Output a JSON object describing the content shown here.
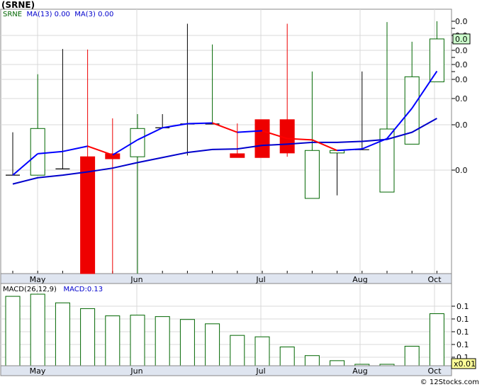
{
  "header": {
    "title": "(SRNE)",
    "legend_symbol": "SRNE",
    "legend_ma13": "MA(13)",
    "legend_ma13_value": "0.00",
    "legend_ma3": "MA(3)",
    "legend_ma3_value": "0.00"
  },
  "macd_panel": {
    "label": "MACD(26,12,9)",
    "value_label": "MACD:0.13"
  },
  "footer": {
    "credit": "© 12Stocks.com"
  },
  "colors": {
    "up_candle": "#006600",
    "down_candle": "#ee0000",
    "ma13": "#0000cc",
    "ma3_up": "#0000ff",
    "ma3_down": "#ff0000",
    "grid": "#d9d9d9",
    "axis_bg": "#dfe5f0",
    "last_price_box": "#ccffcc"
  },
  "chart_data": [
    {
      "type": "candlestick",
      "series_name": "SRNE",
      "x_tick_labels": [
        "May",
        "Jun",
        "Jul",
        "Aug",
        "Oct"
      ],
      "y_tick_labels": [
        "0.0",
        "0.0",
        "0.0",
        "0.0",
        "0.0",
        "0.0",
        "0.0",
        "0.0",
        "0.0"
      ],
      "last_value_label": "0.0",
      "grid": true,
      "ylim": [
        0,
        1
      ],
      "candles": [
        {
          "open": 0.39,
          "high": 0.56,
          "low": 0.39,
          "close": 0.39
        },
        {
          "open": 0.39,
          "high": 0.79,
          "low": 0.39,
          "close": 0.575
        },
        {
          "open": 0.415,
          "high": 0.89,
          "low": 0.415,
          "close": 0.415
        },
        {
          "open": 0.463,
          "high": 0.888,
          "low": 0.0,
          "close": 0.0
        },
        {
          "open": 0.475,
          "high": 0.615,
          "low": 0.0,
          "close": 0.455
        },
        {
          "open": 0.463,
          "high": 0.632,
          "low": 0.0,
          "close": 0.575
        },
        {
          "open": 0.578,
          "high": 0.632,
          "low": 0.578,
          "close": 0.578
        },
        {
          "open": 0.593,
          "high": 0.99,
          "low": 0.468,
          "close": 0.593
        },
        {
          "open": 0.593,
          "high": 0.908,
          "low": 0.593,
          "close": 0.593
        },
        {
          "open": 0.475,
          "high": 0.595,
          "low": 0.475,
          "close": 0.46
        },
        {
          "open": 0.61,
          "high": 0.61,
          "low": 0.463,
          "close": 0.46
        },
        {
          "open": 0.61,
          "high": 0.99,
          "low": 0.463,
          "close": 0.478
        },
        {
          "open": 0.298,
          "high": 0.801,
          "low": 0.298,
          "close": 0.488
        },
        {
          "open": 0.478,
          "high": 0.491,
          "low": 0.31,
          "close": 0.488
        },
        {
          "open": 0.491,
          "high": 0.801,
          "low": 0.491,
          "close": 0.491
        },
        {
          "open": 0.323,
          "high": 0.997,
          "low": 0.323,
          "close": 0.573
        },
        {
          "open": 0.513,
          "high": 0.919,
          "low": 0.513,
          "close": 0.78
        },
        {
          "open": 0.76,
          "high": 1.0,
          "low": 0.76,
          "close": 0.93
        }
      ],
      "ma3": [
        0.39,
        0.475,
        0.484,
        0.505,
        0.47,
        0.53,
        0.578,
        0.594,
        0.597,
        0.56,
        0.566,
        0.535,
        0.53,
        0.488,
        0.494,
        0.535,
        0.655,
        0.802
      ],
      "ma13": [
        0.355,
        0.38,
        0.39,
        0.403,
        0.418,
        0.44,
        0.46,
        0.48,
        0.492,
        0.494,
        0.508,
        0.513,
        0.52,
        0.52,
        0.524,
        0.532,
        0.56,
        0.615
      ]
    },
    {
      "type": "bar",
      "series_name": "MACD",
      "x_tick_labels": [
        "May",
        "Jun",
        "Jul",
        "Aug",
        "Oct"
      ],
      "y_tick_labels": [
        "0.1",
        "0.1",
        "0.1",
        "0.1",
        "0.1",
        "0.1"
      ],
      "multiplier_label": "x0.01",
      "values": [
        0.96,
        0.99,
        0.87,
        0.79,
        0.69,
        0.7,
        0.68,
        0.64,
        0.58,
        0.42,
        0.4,
        0.26,
        0.14,
        0.07,
        0.02,
        0.02,
        0.27,
        0.72
      ]
    }
  ]
}
